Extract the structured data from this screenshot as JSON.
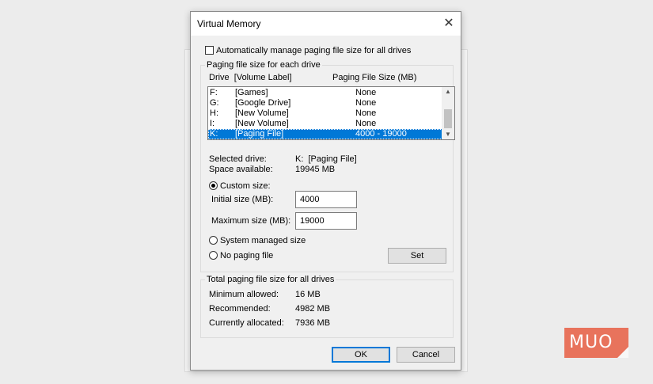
{
  "dialog": {
    "title": "Virtual Memory",
    "auto_manage_label": "Automatically manage paging file size for all drives",
    "auto_manage_checked": false,
    "close_icon": "close-icon"
  },
  "drives_group": {
    "title": "Paging file size for each drive",
    "col_drive": "Drive  [Volume Label]",
    "col_size": "Paging File Size (MB)",
    "rows": [
      {
        "drive": "F:",
        "label": "[Games]",
        "size": "None",
        "selected": false
      },
      {
        "drive": "G:",
        "label": "[Google Drive]",
        "size": "None",
        "selected": false
      },
      {
        "drive": "H:",
        "label": "[New Volume]",
        "size": "None",
        "selected": false
      },
      {
        "drive": "I:",
        "label": "[New Volume]",
        "size": "None",
        "selected": false
      },
      {
        "drive": "K:",
        "label": "[Paging File]",
        "size": "4000 - 19000",
        "selected": true
      }
    ],
    "selected_drive_label": "Selected drive:",
    "selected_drive_value": "K:  [Paging File]",
    "space_available_label": "Space available:",
    "space_available_value": "19945 MB",
    "custom_size_label": "Custom size:",
    "custom_size_checked": true,
    "initial_size_label": "Initial size (MB):",
    "initial_size_value": "4000",
    "maximum_size_label": "Maximum size (MB):",
    "maximum_size_value": "19000",
    "system_managed_label": "System managed size",
    "no_paging_label": "No paging file",
    "set_label": "Set"
  },
  "totals_group": {
    "title": "Total paging file size for all drives",
    "minimum_label": "Minimum allowed:",
    "minimum_value": "16 MB",
    "recommended_label": "Recommended:",
    "recommended_value": "4982 MB",
    "allocated_label": "Currently allocated:",
    "allocated_value": "7936 MB"
  },
  "buttons": {
    "ok_label": "OK",
    "cancel_label": "Cancel"
  },
  "watermark": {
    "text": "MUO",
    "color": "#e8735c"
  },
  "colors": {
    "selection": "#0078d7",
    "dialog_bg": "#f0f0f0"
  }
}
